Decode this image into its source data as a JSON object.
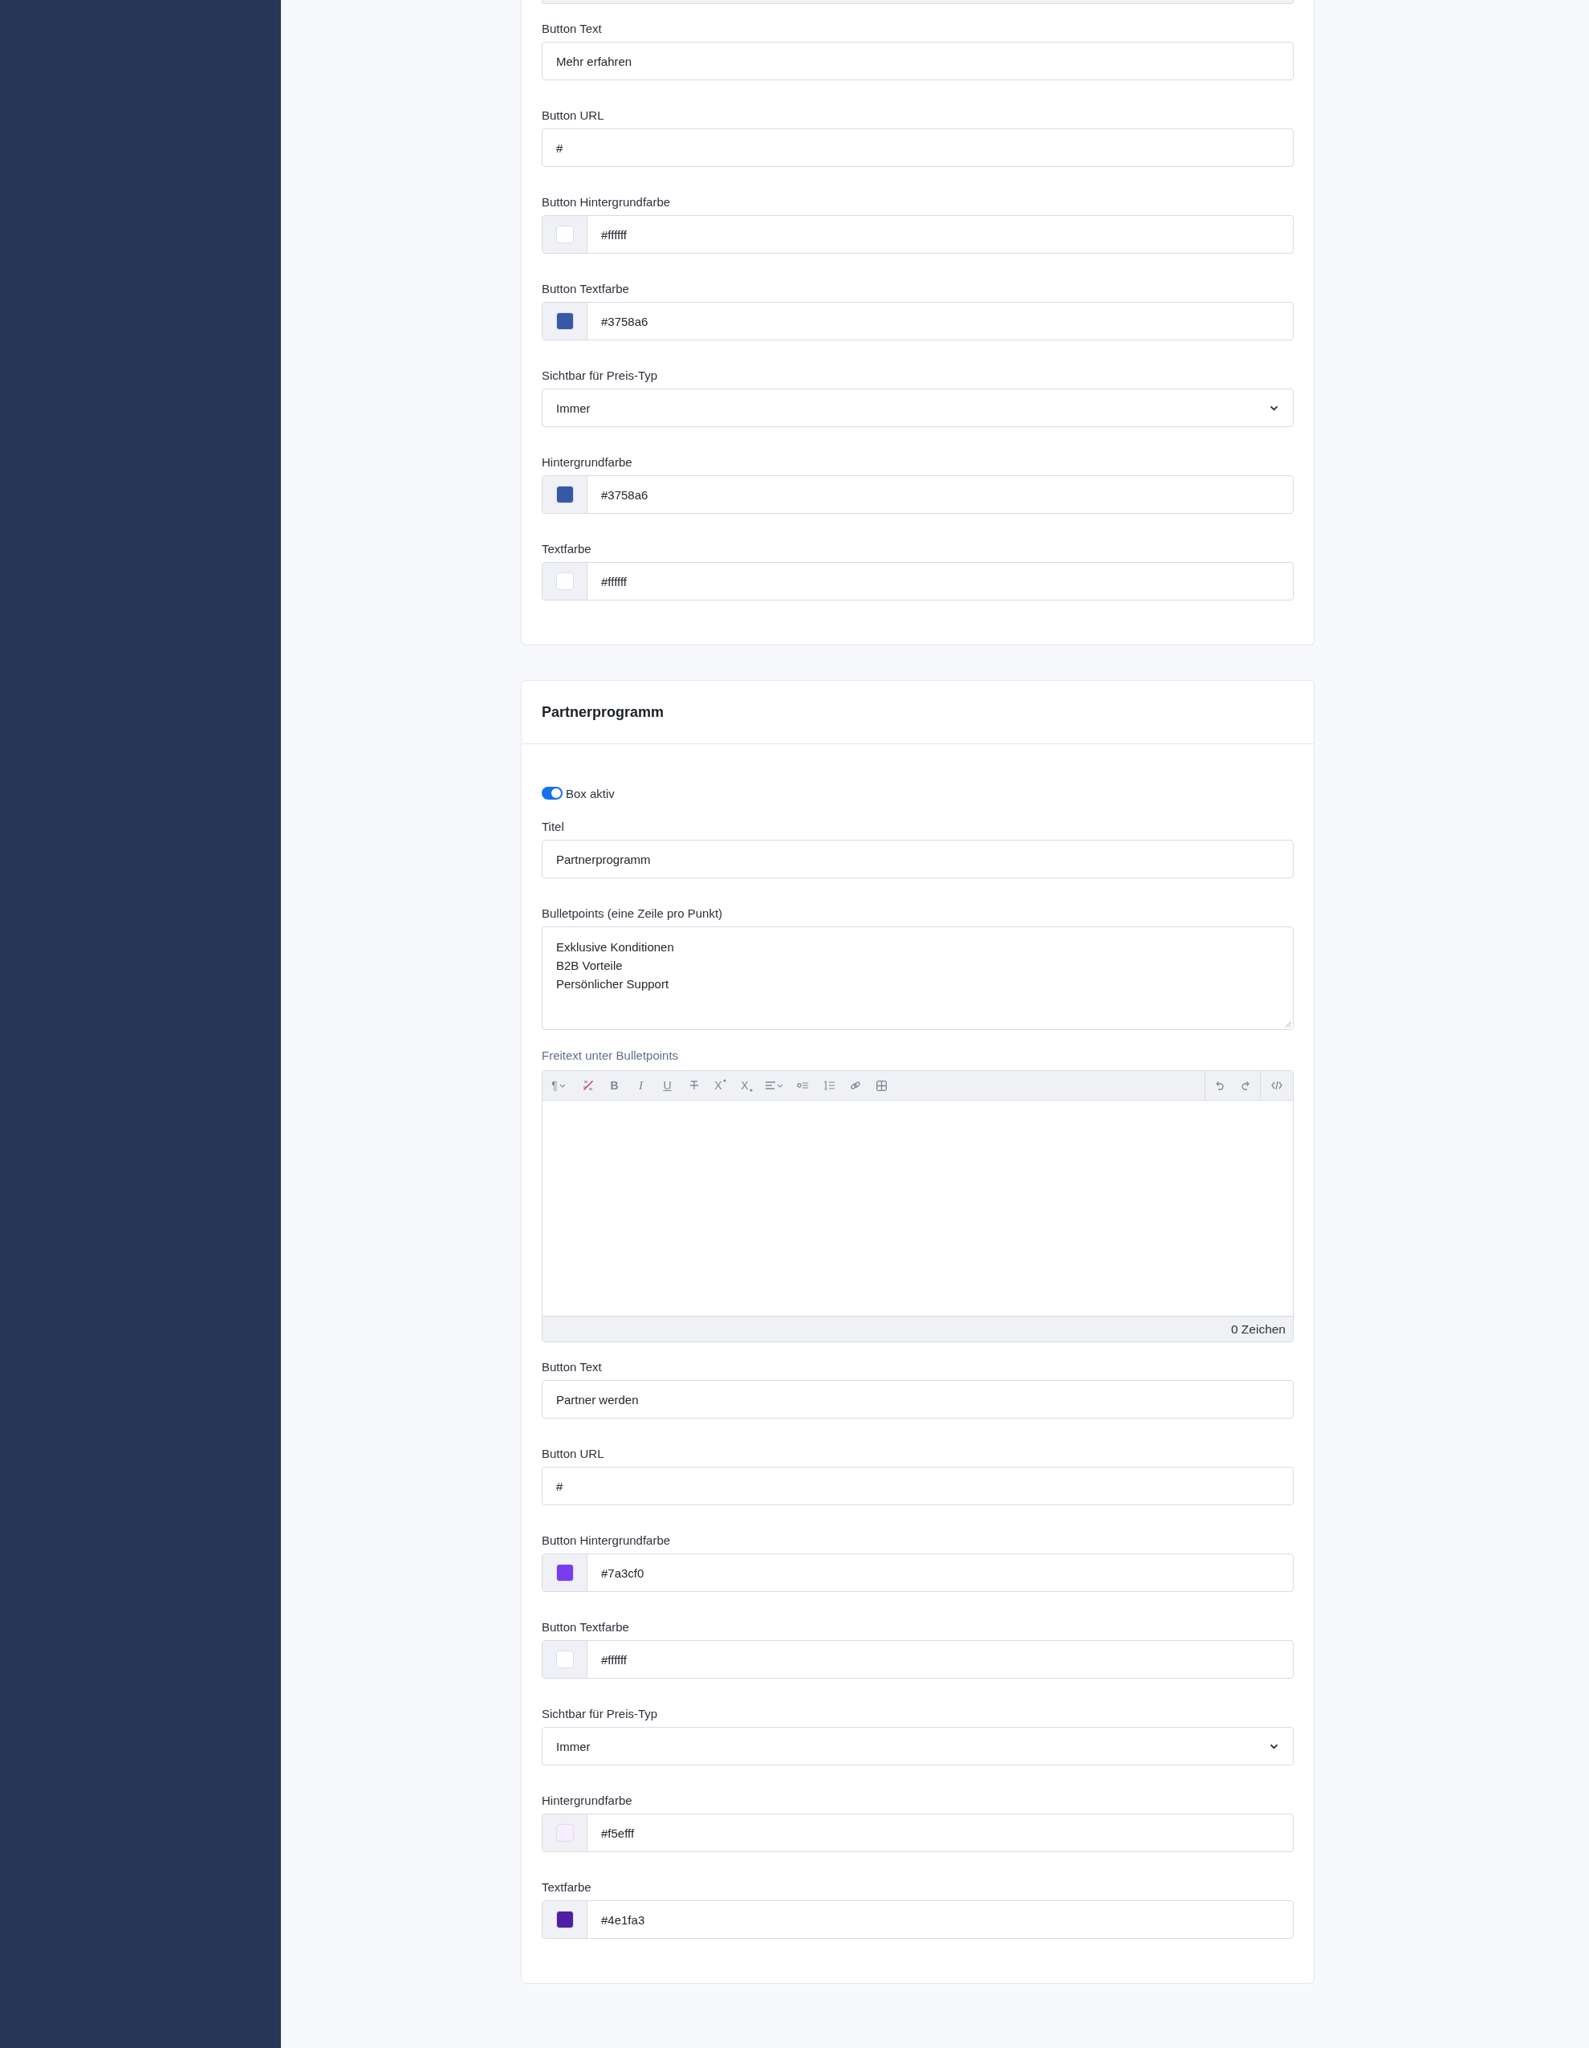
{
  "sections": [
    {
      "cut_off_top": true,
      "fields": [
        {
          "kind": "text",
          "label": "Button Text",
          "value": "Mehr erfahren"
        },
        {
          "kind": "text",
          "label": "Button URL",
          "value": "#"
        },
        {
          "kind": "color",
          "label": "Button Hintergrundfarbe",
          "value": "#ffffff",
          "color": "#ffffff"
        },
        {
          "kind": "color",
          "label": "Button Textfarbe",
          "value": "#3758a6",
          "color": "#3758a6"
        },
        {
          "kind": "select",
          "label": "Sichtbar für Preis-Typ",
          "value": "Immer"
        },
        {
          "kind": "color",
          "label": "Hintergrundfarbe",
          "value": "#3758a6",
          "color": "#3758a6"
        },
        {
          "kind": "color",
          "label": "Textfarbe",
          "value": "#ffffff",
          "color": "#ffffff"
        }
      ]
    },
    {
      "title": "Partnerprogramm",
      "fields": [
        {
          "kind": "toggle",
          "label": "Box aktiv",
          "on": true
        },
        {
          "kind": "text",
          "label": "Titel",
          "value": "Partnerprogramm"
        },
        {
          "kind": "textarea",
          "label": "Bulletpoints (eine Zeile pro Punkt)",
          "lines": [
            "Exklusive Konditionen",
            "B2B Vorteile",
            "Persönlicher Support"
          ]
        },
        {
          "kind": "editor",
          "label": "Freitext unter Bulletpoints",
          "toolbar": [
            [
              {
                "kind": "paragraph",
                "text": "¶"
              },
              {
                "kind": "clear"
              },
              {
                "kind": "bold",
                "text": "B"
              },
              {
                "kind": "italic",
                "text": "I"
              },
              {
                "kind": "underline",
                "text": "U"
              },
              {
                "kind": "strike"
              },
              {
                "kind": "superscript",
                "text": "X"
              },
              {
                "kind": "subscript",
                "text": "X"
              },
              {
                "kind": "align"
              },
              {
                "kind": "bullets"
              },
              {
                "kind": "numbers"
              },
              {
                "kind": "link"
              },
              {
                "kind": "table"
              }
            ],
            [
              {
                "kind": "undo"
              },
              {
                "kind": "redo"
              }
            ],
            [
              {
                "kind": "source"
              }
            ]
          ],
          "counter": "0 Zeichen"
        },
        {
          "kind": "text",
          "label": "Button Text",
          "value": "Partner werden"
        },
        {
          "kind": "text",
          "label": "Button URL",
          "value": "#"
        },
        {
          "kind": "color",
          "label": "Button Hintergrundfarbe",
          "value": "#7a3cf0",
          "color": "#7a3cf0"
        },
        {
          "kind": "color",
          "label": "Button Textfarbe",
          "value": "#ffffff",
          "color": "#ffffff"
        },
        {
          "kind": "select",
          "label": "Sichtbar für Preis-Typ",
          "value": "Immer"
        },
        {
          "kind": "color",
          "label": "Hintergrundfarbe",
          "value": "#f5efff",
          "color": "#f5efff"
        },
        {
          "kind": "color",
          "label": "Textfarbe",
          "value": "#4e1fa3",
          "color": "#4e1fa3"
        }
      ]
    }
  ]
}
